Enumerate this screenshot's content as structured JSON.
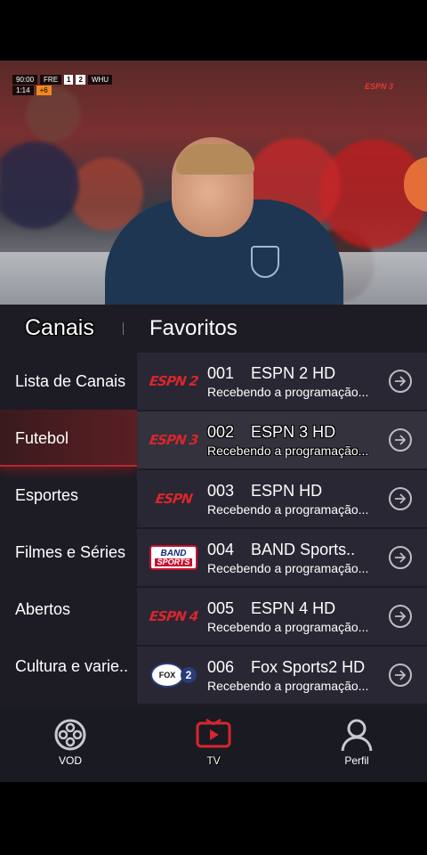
{
  "player": {
    "scoreboard": {
      "time": "90:00",
      "team_home": "FRE",
      "score_home": "1",
      "score_away": "2",
      "team_away": "WHU",
      "sub_time": "1:14",
      "sub_extra": "+6"
    },
    "broadcaster": "ESPN 3"
  },
  "tabs": {
    "canais": "Canais",
    "favoritos": "Favoritos"
  },
  "categories": [
    {
      "label": "Lista de Canais"
    },
    {
      "label": "Futebol"
    },
    {
      "label": "Esportes"
    },
    {
      "label": "Filmes e Séries"
    },
    {
      "label": "Abertos"
    },
    {
      "label": "Cultura e varie.."
    }
  ],
  "channels": [
    {
      "number": "001",
      "name": "ESPN 2 HD",
      "status": "Recebendo a programação...",
      "logo": "ESPN 2"
    },
    {
      "number": "002",
      "name": "ESPN 3 HD",
      "status": "Recebendo a programação...",
      "logo": "ESPN 3"
    },
    {
      "number": "003",
      "name": "ESPN HD",
      "status": "Recebendo a programação...",
      "logo": "ESPN"
    },
    {
      "number": "004",
      "name": "BAND Sports..",
      "status": "Recebendo a programação...",
      "logo_top": "BAND",
      "logo_bottom": "SPORTS"
    },
    {
      "number": "005",
      "name": "ESPN 4 HD",
      "status": "Recebendo a programação...",
      "logo": "ESPN 4"
    },
    {
      "number": "006",
      "name": "Fox Sports2 HD",
      "status": "Recebendo a programação...",
      "logo": "FOX",
      "logo_num": "2"
    }
  ],
  "nav": {
    "vod": "VOD",
    "tv": "TV",
    "perfil": "Perfil"
  },
  "colors": {
    "accent": "#d8262c",
    "panel": "#1d1c25",
    "row": "#282733"
  }
}
